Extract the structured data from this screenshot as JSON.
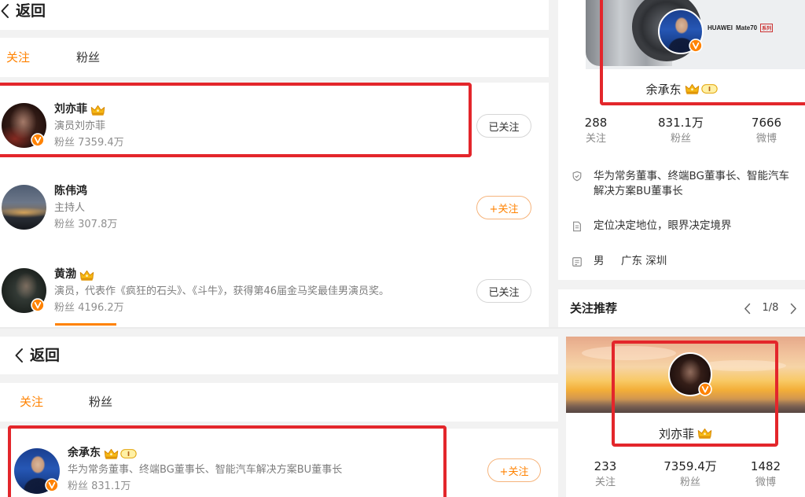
{
  "top_screenshot": {
    "back_label": "返回",
    "tabs": [
      {
        "label": "关注",
        "active": true
      },
      {
        "label": "粉丝",
        "active": false
      }
    ],
    "list": [
      {
        "name": "刘亦菲",
        "desc": "演员刘亦菲",
        "fans": "粉丝 7359.4万",
        "button": "已关注"
      },
      {
        "name": "陈伟鸿",
        "desc": "主持人",
        "fans": "粉丝 307.8万",
        "button": "+关注"
      },
      {
        "name": "黄渤",
        "desc": "演员，代表作《疯狂的石头》、《斗牛》，获得第46届金马奖最佳男演员奖。",
        "fans": "粉丝 4196.2万",
        "button": "已关注"
      }
    ],
    "profile": {
      "banner_brand": "HUAWEI",
      "banner_model": "Mate70",
      "banner_series": "系列",
      "name": "余承东",
      "stats": [
        {
          "value": "288",
          "label": "关注"
        },
        {
          "value": "831.1万",
          "label": "粉丝"
        },
        {
          "value": "7666",
          "label": "微博"
        }
      ],
      "info": {
        "title": "华为常务董事、终端BG董事长、智能汽车解决方案BU董事长",
        "motto": "定位决定地位，眼界决定境界",
        "gender": "男",
        "location": "广东 深圳"
      },
      "info_icons": [
        "shield-icon",
        "document-icon",
        "profile-card-icon"
      ]
    },
    "recommend": {
      "title": "关注推荐",
      "page": "1/8"
    }
  },
  "bottom_screenshot": {
    "back_label": "返回",
    "tabs": [
      {
        "label": "关注",
        "active": true
      },
      {
        "label": "粉丝",
        "active": false
      }
    ],
    "list": [
      {
        "name": "余承东",
        "desc": "华为常务董事、终端BG董事长、智能汽车解决方案BU董事长",
        "fans": "粉丝 831.1万",
        "button": "+关注"
      }
    ],
    "profile": {
      "name": "刘亦菲",
      "stats": [
        {
          "value": "233",
          "label": "关注"
        },
        {
          "value": "7359.4万",
          "label": "粉丝"
        },
        {
          "value": "1482",
          "label": "微博"
        }
      ]
    }
  },
  "icons": [
    "chevron-left-icon",
    "chevron-right-icon",
    "verified-icon",
    "crown-icon",
    "level-badge-icon"
  ],
  "colors": {
    "accent": "#ff8200",
    "highlight": "#e3262b",
    "background": "#f2f2f2"
  }
}
